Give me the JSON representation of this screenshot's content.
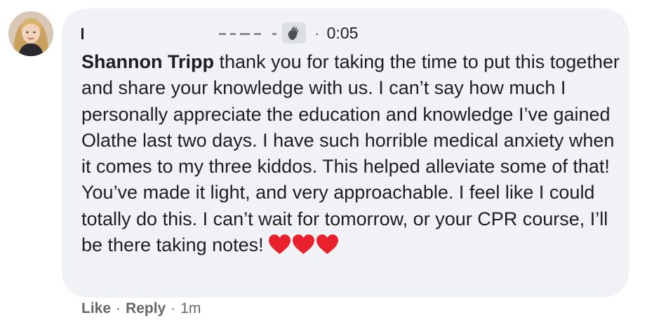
{
  "comment": {
    "time": "0:05",
    "mention": "Shannon Tripp",
    "text": "thank you for taking the time to put this together and share your knowledge with us. I can’t say how much I personally appreciate the education and knowledge I’ve gained Olathe last two days. I have such horrible medical anxiety when it comes to my three kiddos. This helped alleviate some of that! You’ve made it light, and very approachable. I feel like I could totally do this. I can’t wait for tomorrow, or your CPR course, I’ll be there taking notes!",
    "emoji": [
      "heart-icon",
      "heart-icon",
      "heart-icon"
    ],
    "heart_color": "#e8212d"
  },
  "actions": {
    "like": "Like",
    "separator": "·",
    "reply": "Reply",
    "age": "1m"
  },
  "colors": {
    "bubble": "#f0f2f5",
    "text": "#1c1e21",
    "muted": "#65676b"
  }
}
